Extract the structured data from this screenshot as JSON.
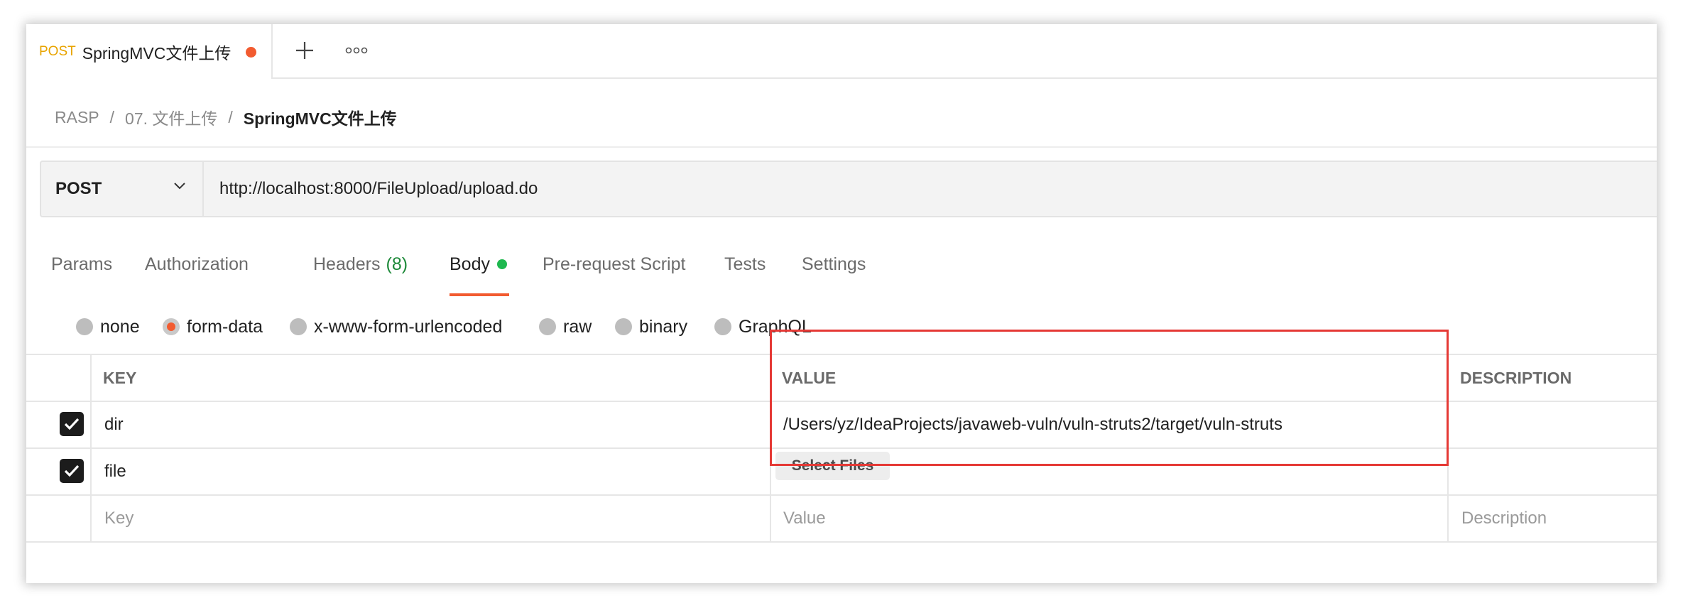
{
  "tab": {
    "method": "POST",
    "name": "SpringMVC文件上传"
  },
  "breadcrumb": {
    "workspace": "RASP",
    "folder": "07. 文件上传",
    "current": "SpringMVC文件上传",
    "separator": "/"
  },
  "request": {
    "method": "POST",
    "url": "http://localhost:8000/FileUpload/upload.do"
  },
  "request_tabs": [
    {
      "label": "Params"
    },
    {
      "label": "Authorization"
    },
    {
      "label": "Headers",
      "count": "(8)"
    },
    {
      "label": "Body",
      "active": true
    },
    {
      "label": "Pre-request Script"
    },
    {
      "label": "Tests"
    },
    {
      "label": "Settings"
    }
  ],
  "body_types": [
    {
      "label": "none",
      "selected": false
    },
    {
      "label": "form-data",
      "selected": true
    },
    {
      "label": "x-www-form-urlencoded",
      "selected": false
    },
    {
      "label": "raw",
      "selected": false
    },
    {
      "label": "binary",
      "selected": false
    },
    {
      "label": "GraphQL",
      "selected": false
    }
  ],
  "table": {
    "headers": {
      "key": "KEY",
      "value": "VALUE",
      "description": "DESCRIPTION"
    },
    "rows": [
      {
        "checked": true,
        "key": "dir",
        "value": "/Users/yz/IdeaProjects/javaweb-vuln/vuln-struts2/target/vuln-struts"
      },
      {
        "checked": true,
        "key": "file",
        "value_button": "Select Files"
      }
    ],
    "placeholders": {
      "key": "Key",
      "value": "Value",
      "description": "Description"
    }
  },
  "colors": {
    "accent": "#f25b30",
    "method_post": "#e8a400",
    "body_dot": "#1eb84f",
    "highlight_box": "#e53935"
  }
}
